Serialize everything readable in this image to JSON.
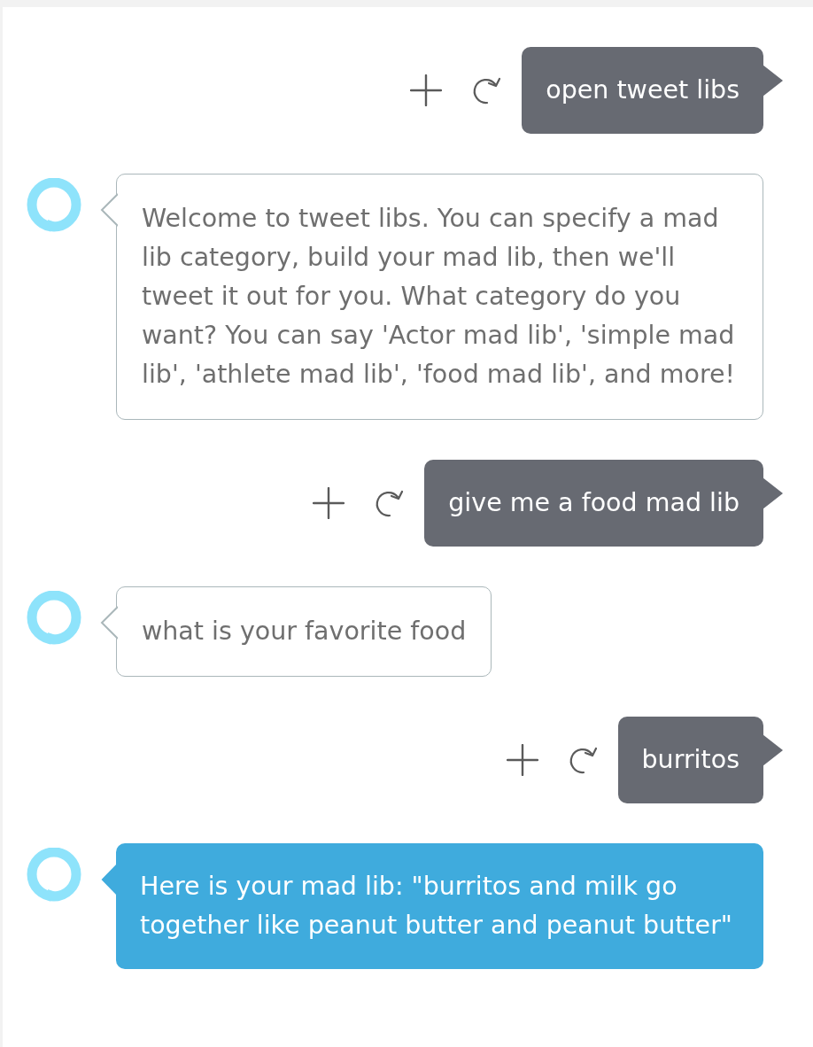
{
  "messages": [
    {
      "kind": "user",
      "text": "open tweet libs",
      "selected": false
    },
    {
      "kind": "alexa",
      "text": "Welcome to tweet libs. You can specify a mad lib category, build your mad lib, then we'll tweet it out for you. What category do you want? You can say 'Actor mad lib', 'simple mad lib', 'athlete mad lib', 'food mad lib', and more!",
      "selected": false
    },
    {
      "kind": "user",
      "text": "give me a food mad lib",
      "selected": false
    },
    {
      "kind": "alexa",
      "text": "what is your favorite food",
      "selected": false
    },
    {
      "kind": "user",
      "text": "burritos",
      "selected": false
    },
    {
      "kind": "alexa",
      "text": "Here is your mad lib: \"burritos and milk go together like peanut butter and peanut butter\"",
      "selected": true
    }
  ]
}
